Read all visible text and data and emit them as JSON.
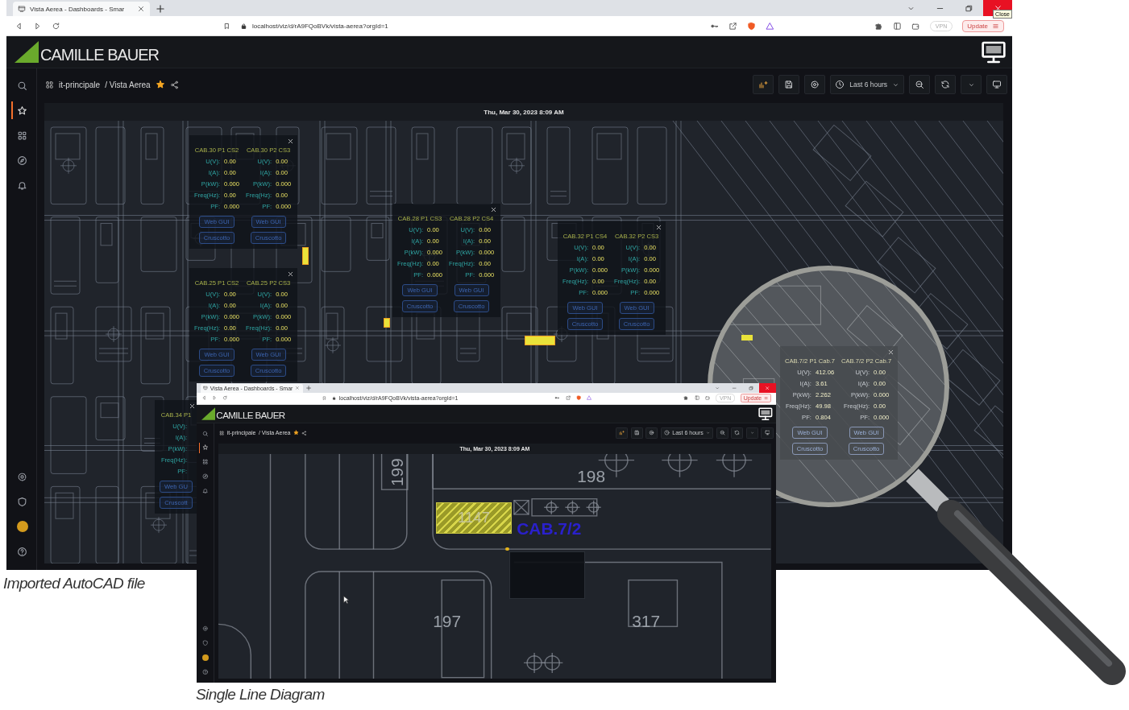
{
  "screens": [
    {
      "kind": "main",
      "browser": {
        "tab_title": "Vista Aerea - Dashboards - Smar",
        "url": "localhost/viz/d/rA9FQoBVk/vista-aerea?orgId=1",
        "vpn": "VPN",
        "update": "Update",
        "tooltip": "Close"
      },
      "logo": "CAMILLE BAUER",
      "breadcrumb": {
        "folder": "it-principale",
        "title": "/ Vista Aerea",
        "starred": true
      },
      "time_range": "Last 6 hours",
      "timestamp": "Thu, Mar 30, 2023 8:09 AM",
      "sidebar": [
        {
          "kind": "search",
          "selected": false
        },
        {
          "kind": "starred",
          "selected": true
        },
        {
          "kind": "dashboards",
          "selected": false
        },
        {
          "kind": "explore",
          "selected": false
        },
        {
          "kind": "alerting",
          "selected": false
        },
        {
          "kind": "settings",
          "selected": false
        },
        {
          "kind": "admin",
          "selected": false
        },
        {
          "kind": "profile",
          "selected": false
        },
        {
          "kind": "help",
          "selected": false
        }
      ],
      "popups": [
        {
          "columns": [
            {
              "title": "CAB.30 P1 CS2",
              "readings": [
                {
                  "label": "U(V):",
                  "value": "0.00"
                },
                {
                  "label": "I(A):",
                  "value": "0.00"
                },
                {
                  "label": "P(kW):",
                  "value": "0.000"
                },
                {
                  "label": "Freq(Hz):",
                  "value": "0.00"
                },
                {
                  "label": "PF:",
                  "value": "0.000"
                }
              ],
              "buttons": [
                "Web GUI",
                "Cruscotto"
              ]
            },
            {
              "title": "CAB.30 P2 CS3",
              "readings": [
                {
                  "label": "U(V):",
                  "value": "0.00"
                },
                {
                  "label": "I(A):",
                  "value": "0.00"
                },
                {
                  "label": "P(kW):",
                  "value": "0.000"
                },
                {
                  "label": "Freq(Hz):",
                  "value": "0.00"
                },
                {
                  "label": "PF:",
                  "value": "0.000"
                }
              ],
              "buttons": [
                "Web GUI",
                "Cruscotto"
              ]
            }
          ]
        },
        {
          "columns": [
            {
              "title": "CAB.25 P1 CS2",
              "readings": [
                {
                  "label": "U(V):",
                  "value": "0.00"
                },
                {
                  "label": "I(A):",
                  "value": "0.00"
                },
                {
                  "label": "P(kW):",
                  "value": "0.000"
                },
                {
                  "label": "Freq(Hz):",
                  "value": "0.00"
                },
                {
                  "label": "PF:",
                  "value": "0.000"
                }
              ],
              "buttons": [
                "Web GUI",
                "Cruscotto"
              ]
            },
            {
              "title": "CAB.25 P2 CS3",
              "readings": [
                {
                  "label": "U(V):",
                  "value": "0.00"
                },
                {
                  "label": "I(A):",
                  "value": "0.00"
                },
                {
                  "label": "P(kW):",
                  "value": "0.000"
                },
                {
                  "label": "Freq(Hz):",
                  "value": "0.00"
                },
                {
                  "label": "PF:",
                  "value": "0.000"
                }
              ],
              "buttons": [
                "Web GUI",
                "Cruscotto"
              ]
            }
          ]
        },
        {
          "columns": [
            {
              "title": "CAB.28 P1 CS3",
              "readings": [
                {
                  "label": "U(V):",
                  "value": "0.00"
                },
                {
                  "label": "I(A):",
                  "value": "0.00"
                },
                {
                  "label": "P(kW):",
                  "value": "0.000"
                },
                {
                  "label": "Freq(Hz):",
                  "value": "0.00"
                },
                {
                  "label": "PF:",
                  "value": "0.000"
                }
              ],
              "buttons": [
                "Web GUI",
                "Cruscotto"
              ]
            },
            {
              "title": "CAB.28 P2 CS4",
              "readings": [
                {
                  "label": "U(V):",
                  "value": "0.00"
                },
                {
                  "label": "I(A):",
                  "value": "0.00"
                },
                {
                  "label": "P(kW):",
                  "value": "0.000"
                },
                {
                  "label": "Freq(Hz):",
                  "value": "0.00"
                },
                {
                  "label": "PF:",
                  "value": "0.000"
                }
              ],
              "buttons": [
                "Web GUI",
                "Cruscotto"
              ]
            }
          ]
        },
        {
          "columns": [
            {
              "title": "CAB.32 P1 CS4",
              "readings": [
                {
                  "label": "U(V):",
                  "value": "0.00"
                },
                {
                  "label": "I(A):",
                  "value": "0.00"
                },
                {
                  "label": "P(kW):",
                  "value": "0.000"
                },
                {
                  "label": "Freq(Hz):",
                  "value": "0.00"
                },
                {
                  "label": "PF:",
                  "value": "0.000"
                }
              ],
              "buttons": [
                "Web GUI",
                "Cruscotto"
              ]
            },
            {
              "title": "CAB.32 P2 CS3",
              "readings": [
                {
                  "label": "U(V):",
                  "value": "0.00"
                },
                {
                  "label": "I(A):",
                  "value": "0.00"
                },
                {
                  "label": "P(kW):",
                  "value": "0.000"
                },
                {
                  "label": "Freq(Hz):",
                  "value": "0.00"
                },
                {
                  "label": "PF:",
                  "value": "0.000"
                }
              ],
              "buttons": [
                "Web GUI",
                "Cruscotto"
              ]
            }
          ]
        },
        {
          "columns": [
            {
              "title": "CAB.34 P1",
              "readings": [
                {
                  "label": "U(V):"
                },
                {
                  "label": "I(A):"
                },
                {
                  "label": "P(kW):"
                },
                {
                  "label": "Freq(Hz):"
                },
                {
                  "label": "PF:"
                }
              ],
              "buttons": [
                "Web GU",
                "Cruscott"
              ]
            }
          ]
        }
      ]
    },
    {
      "kind": "detail",
      "browser": {
        "tab_title": "Vista Aerea - Dashboards - Smar",
        "url": "localhost/viz/d/rA9FQoBVk/vista-aerea?orgId=1",
        "vpn": "VPN",
        "update": "Update"
      },
      "logo": "CAMILLE BAUER",
      "breadcrumb": {
        "folder": "it-principale",
        "title": "/ Vista Aerea",
        "starred": true
      },
      "time_range": "Last 6 hours",
      "timestamp": "Thu, Mar 30, 2023 8:09 AM",
      "sidebar": [
        {
          "kind": "search",
          "selected": false
        },
        {
          "kind": "starred",
          "selected": true
        },
        {
          "kind": "dashboards",
          "selected": false
        },
        {
          "kind": "explore",
          "selected": false
        },
        {
          "kind": "alerting",
          "selected": false
        },
        {
          "kind": "settings",
          "selected": false
        },
        {
          "kind": "admin",
          "selected": false
        },
        {
          "kind": "profile",
          "selected": false
        },
        {
          "kind": "help",
          "selected": false
        }
      ],
      "map_labels": [
        {
          "kind": "room_vertical",
          "text": "199"
        },
        {
          "kind": "room",
          "text": "198"
        },
        {
          "kind": "area",
          "text": "1147"
        },
        {
          "kind": "cabinet",
          "text": "CAB.7/2"
        },
        {
          "kind": "room",
          "text": "197"
        },
        {
          "kind": "room",
          "text": "317"
        }
      ]
    }
  ],
  "magnifier": {
    "popup": {
      "columns": [
        {
          "title": "CAB.7/2 P1 Cab.7",
          "readings": [
            {
              "label": "U(V):",
              "value": "412.06"
            },
            {
              "label": "I(A):",
              "value": "3.61"
            },
            {
              "label": "P(kW):",
              "value": "2.262"
            },
            {
              "label": "Freq(Hz):",
              "value": "49.98"
            },
            {
              "label": "PF:",
              "value": "0.804"
            }
          ],
          "buttons": [
            "Web GUI",
            "Cruscotto"
          ]
        },
        {
          "title": "CAB.7/2 P2 Cab.7",
          "readings": [
            {
              "label": "U(V):",
              "value": "0.00"
            },
            {
              "label": "I(A):",
              "value": "0.00"
            },
            {
              "label": "P(kW):",
              "value": "0.000"
            },
            {
              "label": "Freq(Hz):",
              "value": "0.00"
            },
            {
              "label": "PF:",
              "value": "0.000"
            }
          ],
          "buttons": [
            "Web GUI",
            "Cruscotto"
          ]
        }
      ]
    }
  },
  "captions": [
    "Imported AutoCAD file",
    "Single Line Diagram"
  ]
}
